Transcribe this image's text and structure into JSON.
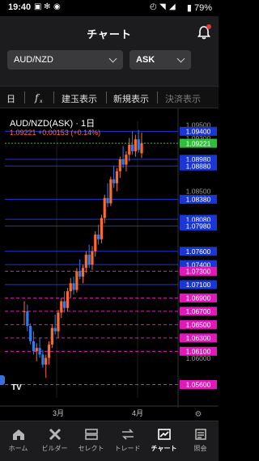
{
  "status_bar": {
    "time": "19:40",
    "battery": "79%"
  },
  "header": {
    "title": "チャート"
  },
  "selectors": {
    "pair": "AUD/NZD",
    "side": "ASK"
  },
  "toolbar": {
    "item1": "日",
    "item2": "建玉表示",
    "item3": "新規表示",
    "item4": "決済表示"
  },
  "chart_header": {
    "symbol": "AUD/NZD(ASK) · 1日",
    "quote": "1.09221 +0.00153 (+0.14%)"
  },
  "chart_data": {
    "type": "candlestick",
    "price_range": [
      1.054,
      1.0955
    ],
    "price_ticks": [
      "1.09500",
      "1.09400",
      "1.09300",
      "1.09221",
      "1.08980",
      "1.08880",
      "1.08500",
      "1.08380",
      "1.08080",
      "1.07980",
      "1.07600",
      "1.07400",
      "1.07300",
      "1.07100",
      "1.06900",
      "1.06700",
      "1.06500",
      "1.06300",
      "1.06100",
      "1.06000",
      "1.05600"
    ],
    "last_price": "1.09221",
    "x_ticks": [
      "3月",
      "4月"
    ],
    "blue_lines": [
      1.094,
      1.0898,
      1.0888,
      1.0838,
      1.0808,
      1.0798,
      1.076,
      1.074,
      1.071
    ],
    "magenta_lines": [
      1.073,
      1.069,
      1.067,
      1.065,
      1.063,
      1.061,
      1.056
    ],
    "candles": [
      [
        1.067,
        1.0685,
        1.065,
        1.067
      ],
      [
        1.067,
        1.068,
        1.064,
        1.0648
      ],
      [
        1.0648,
        1.0652,
        1.062,
        1.0625
      ],
      [
        1.0625,
        1.064,
        1.0605,
        1.061
      ],
      [
        1.061,
        1.0622,
        1.0595,
        1.0615
      ],
      [
        1.0615,
        1.063,
        1.06,
        1.0605
      ],
      [
        1.0605,
        1.0612,
        1.0585,
        1.059
      ],
      [
        1.059,
        1.0605,
        1.057,
        1.06
      ],
      [
        1.06,
        1.0625,
        1.059,
        1.062
      ],
      [
        1.062,
        1.065,
        1.0615,
        1.0645
      ],
      [
        1.0645,
        1.0665,
        1.0635,
        1.064
      ],
      [
        1.064,
        1.0672,
        1.063,
        1.0668
      ],
      [
        1.0668,
        1.069,
        1.066,
        1.0685
      ],
      [
        1.0685,
        1.07,
        1.0668,
        1.0675
      ],
      [
        1.0675,
        1.0705,
        1.067,
        1.07
      ],
      [
        1.07,
        1.072,
        1.069,
        1.0712
      ],
      [
        1.0712,
        1.0722,
        1.0695,
        1.0702
      ],
      [
        1.0702,
        1.0735,
        1.0698,
        1.073
      ],
      [
        1.073,
        1.0748,
        1.0718,
        1.0722
      ],
      [
        1.0722,
        1.074,
        1.0712,
        1.0735
      ],
      [
        1.0735,
        1.076,
        1.0728,
        1.0755
      ],
      [
        1.0755,
        1.077,
        1.0735,
        1.074
      ],
      [
        1.074,
        1.0768,
        1.0732,
        1.076
      ],
      [
        1.076,
        1.079,
        1.0752,
        1.0785
      ],
      [
        1.0785,
        1.08,
        1.077,
        1.0778
      ],
      [
        1.0778,
        1.0815,
        1.0772,
        1.081
      ],
      [
        1.081,
        1.0845,
        1.0802,
        1.084
      ],
      [
        1.084,
        1.0862,
        1.0826,
        1.0832
      ],
      [
        1.0832,
        1.0872,
        1.0828,
        1.0868
      ],
      [
        1.0868,
        1.0888,
        1.0855,
        1.0862
      ],
      [
        1.0862,
        1.0885,
        1.085,
        1.088
      ],
      [
        1.088,
        1.0902,
        1.087,
        1.0898
      ],
      [
        1.0898,
        1.0918,
        1.0885,
        1.089
      ],
      [
        1.089,
        1.091,
        1.088,
        1.0905
      ],
      [
        1.0905,
        1.093,
        1.0895,
        1.092
      ],
      [
        1.092,
        1.094,
        1.0905,
        1.091
      ],
      [
        1.091,
        1.0935,
        1.0902,
        1.0928
      ],
      [
        1.0928,
        1.0942,
        1.0908,
        1.0912
      ],
      [
        1.0907,
        1.0938,
        1.09,
        1.0922
      ]
    ],
    "colors": {
      "up": "#ff6a2b",
      "down": "#2d7df0",
      "blue_line": "#1a37d6",
      "magenta_line": "#e01ab8",
      "last": "#2fbf3a"
    }
  },
  "bottom_nav": [
    {
      "label": "ホーム",
      "icon": "home-icon"
    },
    {
      "label": "ビルダー",
      "icon": "tools-icon"
    },
    {
      "label": "セレクト",
      "icon": "select-icon"
    },
    {
      "label": "トレード",
      "icon": "trade-icon"
    },
    {
      "label": "チャート",
      "icon": "chart-icon",
      "active": true
    },
    {
      "label": "照会",
      "icon": "inquiry-icon"
    }
  ]
}
